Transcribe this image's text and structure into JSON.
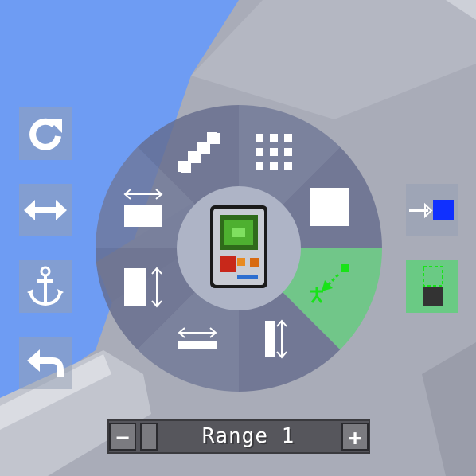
{
  "colors": {
    "sky": "#6e9cf3",
    "ground": "#a9acb8",
    "wheel": "#6b7596",
    "highlight": "#5fcf7a",
    "center": "#aeb4c6",
    "blue_square": "#1030ff",
    "green_dot": "#18e318"
  },
  "left_buttons": [
    {
      "icon": "rotate-icon"
    },
    {
      "icon": "mirror-horizontal-icon"
    },
    {
      "icon": "anchor-icon"
    },
    {
      "icon": "undo-icon"
    }
  ],
  "right_buttons": [
    {
      "icon": "replace-mode-icon"
    },
    {
      "icon": "fill-block-icon",
      "active": true
    }
  ],
  "wheel_segments": [
    {
      "icon": "grid-icon"
    },
    {
      "icon": "solid-block-icon"
    },
    {
      "icon": "line-tool-icon",
      "selected": true
    },
    {
      "icon": "vertical-wall-icon"
    },
    {
      "icon": "floor-icon"
    },
    {
      "icon": "wall-height-icon"
    },
    {
      "icon": "wall-width-icon"
    },
    {
      "icon": "stairs-icon"
    }
  ],
  "center_item": {
    "icon": "building-gadget-icon"
  },
  "range": {
    "minus_label": "−",
    "plus_label": "+",
    "label": "Range 1",
    "value": 1
  }
}
